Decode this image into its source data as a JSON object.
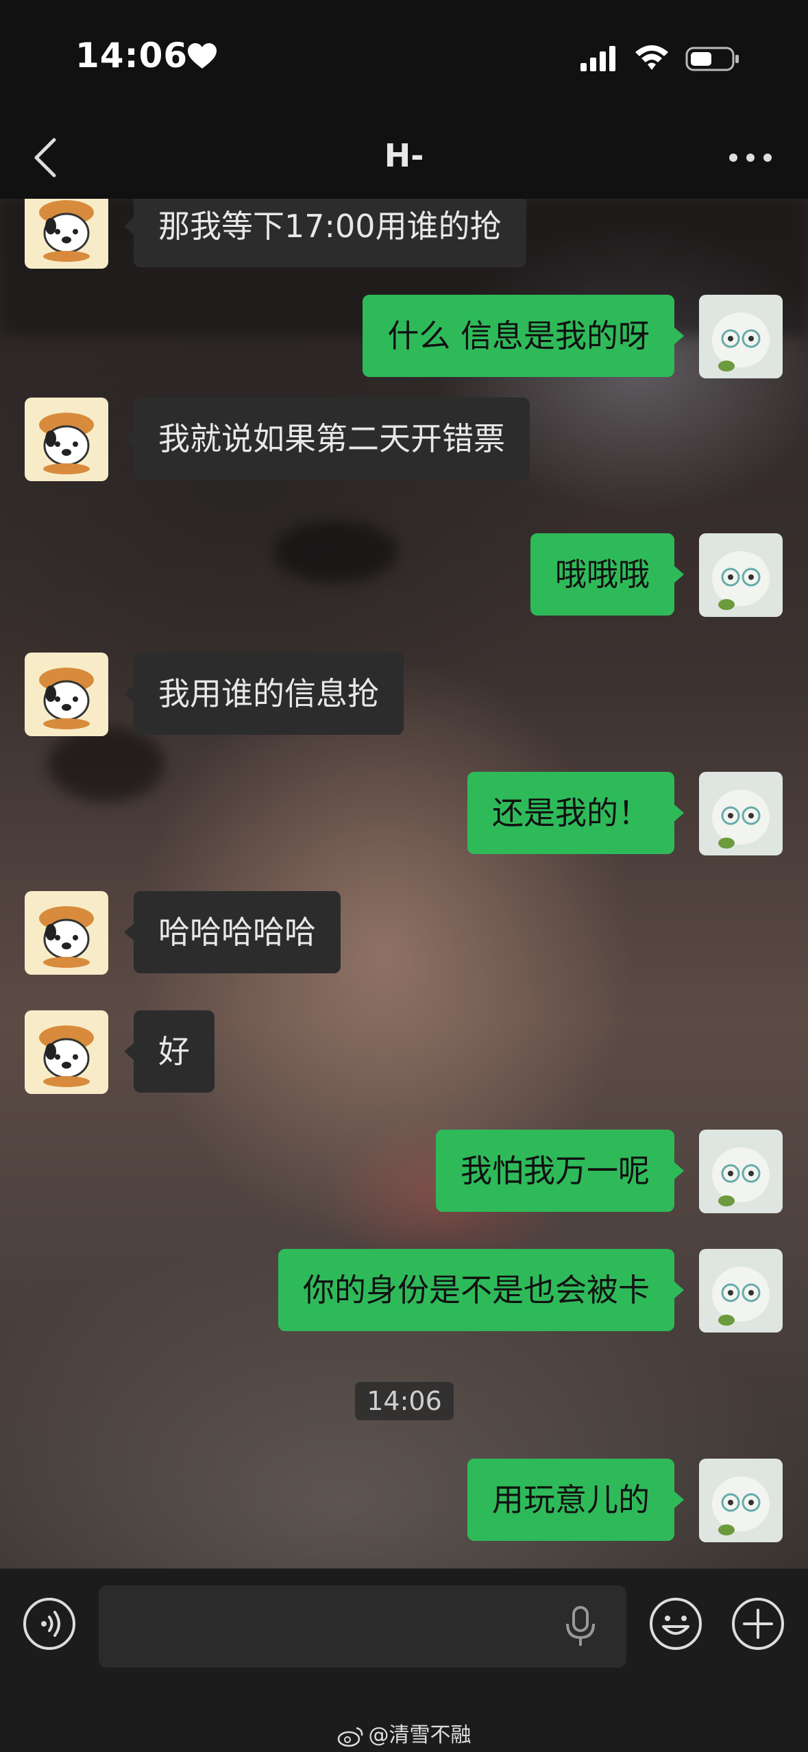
{
  "status_bar": {
    "time": "14:06"
  },
  "nav": {
    "title": "H-"
  },
  "messages": [
    {
      "side": "left",
      "text": "那我等下17:00用谁的抢"
    },
    {
      "side": "right",
      "text": "什么 信息是我的呀"
    },
    {
      "side": "left",
      "text": "我就说如果第二天开错票"
    },
    {
      "side": "right",
      "text": "哦哦哦"
    },
    {
      "side": "left",
      "text": "我用谁的信息抢"
    },
    {
      "side": "right",
      "text": "还是我的！"
    },
    {
      "side": "left",
      "text": "哈哈哈哈哈"
    },
    {
      "side": "left",
      "text": "好"
    },
    {
      "side": "right",
      "text": "我怕我万一呢"
    },
    {
      "side": "right",
      "text": "你的身份是不是也会被卡"
    },
    {
      "side": "right",
      "text": "用玩意儿的"
    }
  ],
  "timestamp": "14:06",
  "input": {
    "value": "",
    "placeholder": ""
  },
  "watermark": "@清雪不融",
  "colors": {
    "sent_bubble": "#2fba5a",
    "received_bubble": "#2c2c2c",
    "bar": "#1c1c1c"
  }
}
